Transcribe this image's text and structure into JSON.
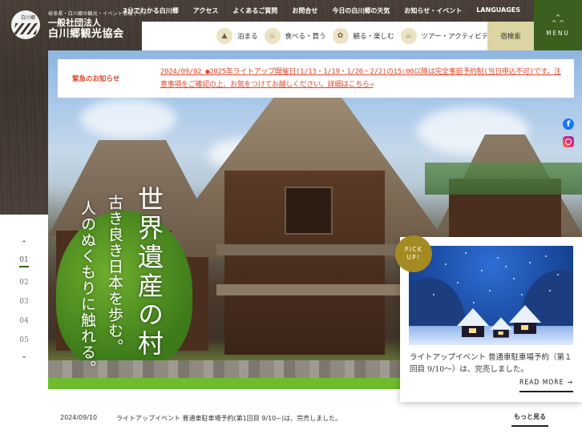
{
  "header": {
    "logo": {
      "tagline": "岐阜県・白川郷の観光・イベント情報サイト",
      "org_type": "一般社団法人",
      "org_name": "白川郷観光協会",
      "mark_text": "白川郷"
    },
    "top_nav": [
      {
        "label": "3分でわかる白川郷"
      },
      {
        "label": "アクセス"
      },
      {
        "label": "よくあるご質問"
      },
      {
        "label": "お問合せ"
      },
      {
        "label": "今日の白川郷の天気"
      },
      {
        "label": "お知らせ・イベント"
      },
      {
        "label": "LANGUAGES"
      }
    ],
    "sub_nav": [
      {
        "label": "泊まる",
        "icon": "lodging-icon",
        "glyph": "▲"
      },
      {
        "label": "食べる・買う",
        "icon": "food-icon",
        "glyph": "♨"
      },
      {
        "label": "観る・楽しむ",
        "icon": "sightseeing-icon",
        "glyph": "✿"
      },
      {
        "label": "ツアー・アクティビティ",
        "icon": "tour-icon",
        "glyph": "⌓"
      }
    ],
    "lodging_search": "宿検索",
    "menu": {
      "label": "MENU",
      "chevron": "^\n^ ^"
    }
  },
  "notice": {
    "label": "緊急のお知らせ",
    "text": "2024/09/02 ●2025年ライトアップ開催日(1/13・1/19・1/26・2/2)の15:00以降は完全事前予約制(当日申込不可)です。注意事項をご確認の上、お気をつけてお越しください。詳細はこちら⇒"
  },
  "hero": {
    "copy_main": "世界遺産の村",
    "copy_sub1": "古き良き日本を歩む。",
    "copy_sub2": "人のぬくもりに触れる。"
  },
  "social": [
    {
      "name": "facebook",
      "glyph": "f"
    },
    {
      "name": "instagram",
      "glyph": ""
    }
  ],
  "pager": {
    "up": "⌃",
    "down": "⌄",
    "slides": [
      "01",
      "02",
      "03",
      "04",
      "05"
    ],
    "active_index": 0
  },
  "pickup": {
    "badge": "PICK\nUP!",
    "title": "ライトアップイベント 普通車駐車場予約（第１回目 9/10～）は、完売しました。",
    "read_more": "READ MORE",
    "arrow": "→"
  },
  "news": {
    "items": [
      {
        "date": "2024/09/10",
        "title": "ライトアップイベント 普通車駐車場予約(第1回目 9/10~)は、完売しました。"
      }
    ],
    "more_label": "もっと見る"
  },
  "colors": {
    "accent_green": "#3c5e1e",
    "notice_red": "#e0462a",
    "badge_gold": "#a48a22",
    "lodging_beige": "#dcd5a3",
    "wood_brown": "#3d332c"
  }
}
